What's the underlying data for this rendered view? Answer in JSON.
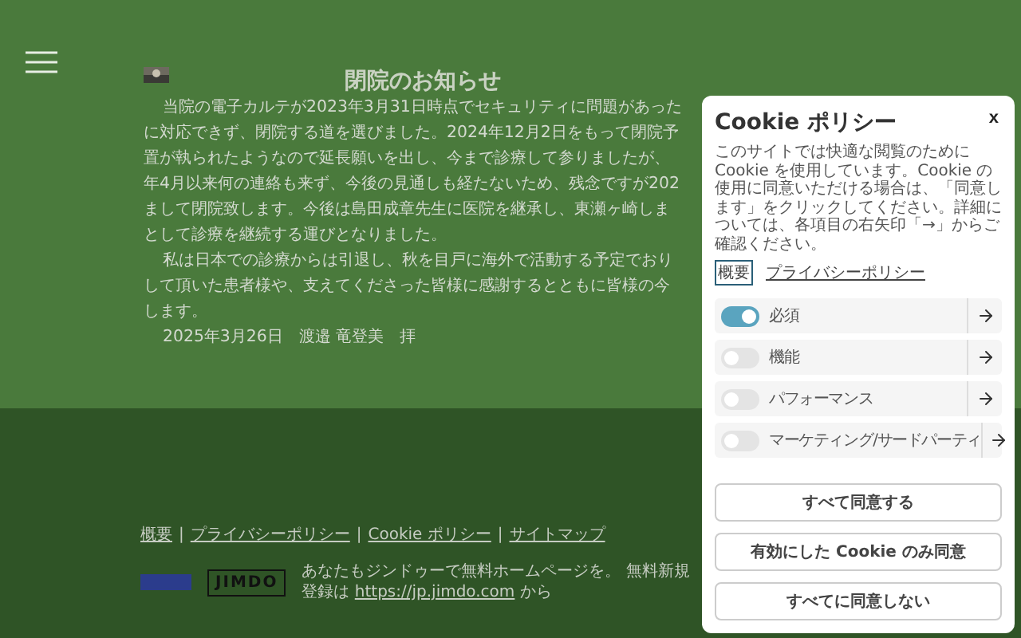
{
  "notice": {
    "title": "閉院のお知らせ",
    "paragraphs": [
      {
        "lines": [
          "当院の電子カルテが2023年3月31日時点でセキュリティに問題があった",
          "に対応できず、閉院する道を選びました。2024年12月2日をもって閉院予",
          "置が執られたようなので延長願いを出し、今まで診療して参りましたが、",
          "年4月以来何の連絡も来ず、今後の見通しも経たないため、残念ですが202",
          "まして閉院致します。今後は島田成章先生に医院を継承し、東瀬ヶ崎しま",
          "として診療を継続する運びとなりました。"
        ]
      },
      {
        "lines": [
          "私は日本での診療からは引退し、秋を目戸に海外で活動する予定でおり",
          "して頂いた患者様や、支えてくださった皆様に感謝するとともに皆様の今",
          "します。"
        ]
      },
      {
        "lines": [
          "2025年3月26日　渡邉 竜登美　拝"
        ]
      }
    ]
  },
  "footer": {
    "links": [
      "概要",
      "プライバシーポリシー",
      "Cookie ポリシー",
      "サイトマップ"
    ],
    "separator": "|",
    "logo": "JIMDO",
    "promo": "あなたもジンドゥーで無料ホームページを。 無料新規登録は",
    "promo_link": "https://jp.jimdo.com",
    "promo_end": "から"
  },
  "cookie": {
    "title": "Cookie ポリシー",
    "close": "x",
    "description": "このサイトでは快適な閲覧のために Cookie を使用しています。Cookie の使用に同意いただける場合は、「同意します」をクリックしてください。詳細については、各項目の右矢印「→」からご確認ください。",
    "tabs": [
      {
        "label": "概要",
        "selected": true
      },
      {
        "label": "プライバシーポリシー",
        "selected": false
      }
    ],
    "categories": [
      {
        "label": "必須",
        "on": true
      },
      {
        "label": "機能",
        "on": false
      },
      {
        "label": "パフォーマンス",
        "on": false
      },
      {
        "label": "マーケティング/サードパーティ",
        "on": false
      }
    ],
    "buttons": [
      "すべて同意する",
      "有効にした Cookie のみ同意",
      "すべてに同意しない"
    ]
  }
}
